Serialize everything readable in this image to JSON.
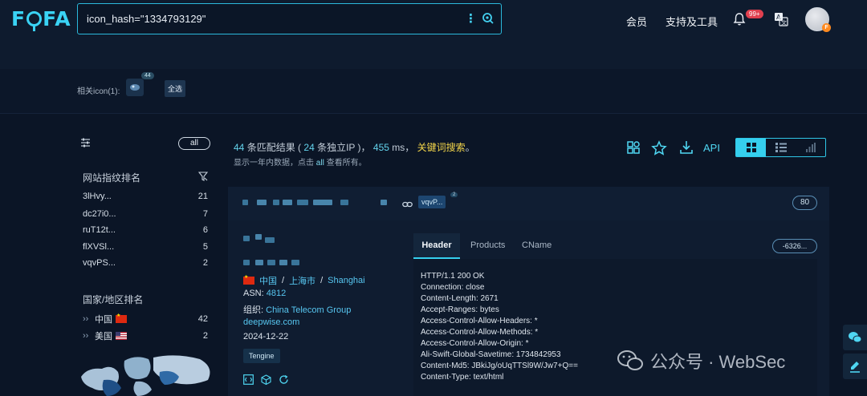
{
  "header": {
    "logo": "FOFA",
    "search_value": "icon_hash=\"1334793129\"",
    "nav": [
      "会员",
      "支持及工具"
    ],
    "notification_badge": "99+",
    "avatar_badge": "F"
  },
  "related": {
    "label": "相关icon(1):",
    "icon_count": "44",
    "select_all": "全选"
  },
  "sidebar": {
    "all_label": "all",
    "fingerprint_title": "网站指纹排名",
    "fingerprints": [
      {
        "name": "3lHvy...",
        "count": "21"
      },
      {
        "name": "dc27i0...",
        "count": "7"
      },
      {
        "name": "ruT12t...",
        "count": "6"
      },
      {
        "name": "flXVSl...",
        "count": "5"
      },
      {
        "name": "vqvPS...",
        "count": "2"
      }
    ],
    "country_title": "国家/地区排名",
    "countries": [
      {
        "name": "中国",
        "count": "42"
      },
      {
        "name": "美国",
        "count": "2"
      }
    ]
  },
  "results": {
    "total": "44",
    "text1": "条匹配结果 (",
    "ips": "24",
    "text2": "条独立IP )，",
    "ms": "455",
    "text3": "ms，",
    "keyword_link": "关键词搜索",
    "text4": "。",
    "sub_prefix": "显示一年内数据，点击",
    "sub_all": "all",
    "sub_suffix": "查看所有。",
    "api_label": "API"
  },
  "card": {
    "tag": "vqvP...",
    "tag_count": "2",
    "port": "80",
    "country": "中国",
    "region": "上海市",
    "city": "Shanghai",
    "asn_label": "ASN:",
    "asn": "4812",
    "org_label": "组织:",
    "org": "China Telecom Group",
    "domain": "deepwise.com",
    "date": "2024-12-22",
    "server": "Tengine",
    "tabs": [
      "Header",
      "Products",
      "CName"
    ],
    "hash_pill": "-6326...",
    "http_lines": [
      "HTTP/1.1 200 OK",
      "Connection: close",
      "Content-Length: 2671",
      "Accept-Ranges: bytes",
      "Access-Control-Allow-Headers: *",
      "Access-Control-Allow-Methods: *",
      "Access-Control-Allow-Origin: *",
      "Ali-Swift-Global-Savetime: 1734842953",
      "Content-Md5: JBkiJg/oUqTTSl9W/Jw7+Q==",
      "Content-Type: text/html"
    ]
  },
  "watermark": "公众号 · WebSec",
  "colors": {
    "accent": "#35cfee",
    "keyword": "#f3d54a",
    "background": "#0b1526"
  }
}
